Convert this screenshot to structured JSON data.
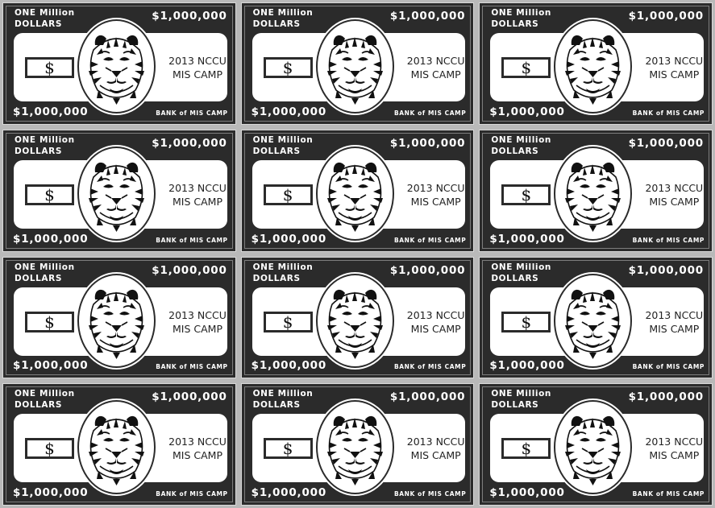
{
  "bills": [
    {
      "denomination_words": "ONE Million\nDOLLARS",
      "amount_top": "$1,000,000",
      "amount_bottom": "$1,000,000",
      "currency_symbol": "$",
      "camp_line1": "2013 NCCU",
      "camp_line2": "MIS CAMP",
      "bank": "BANK of MIS CAMP"
    },
    {
      "denomination_words": "ONE Million\nDOLLARS",
      "amount_top": "$1,000,000",
      "amount_bottom": "$1,000,000",
      "currency_symbol": "$",
      "camp_line1": "2013 NCCU",
      "camp_line2": "MIS CAMP",
      "bank": "BANK of MIS CAMP"
    },
    {
      "denomination_words": "ONE Million\nDOLLARS",
      "amount_top": "$1,000,000",
      "amount_bottom": "$1,000,000",
      "currency_symbol": "$",
      "camp_line1": "2013 NCCU",
      "camp_line2": "MIS CAMP",
      "bank": "BANK of MIS CAMP"
    },
    {
      "denomination_words": "ONE Million\nDOLLARS",
      "amount_top": "$1,000,000",
      "amount_bottom": "$1,000,000",
      "currency_symbol": "$",
      "camp_line1": "2013 NCCU",
      "camp_line2": "MIS CAMP",
      "bank": "BANK of MIS CAMP"
    },
    {
      "denomination_words": "ONE Million\nDOLLARS",
      "amount_top": "$1,000,000",
      "amount_bottom": "$1,000,000",
      "currency_symbol": "$",
      "camp_line1": "2013 NCCU",
      "camp_line2": "MIS CAMP",
      "bank": "BANK of MIS CAMP"
    },
    {
      "denomination_words": "ONE Million\nDOLLARS",
      "amount_top": "$1,000,000",
      "amount_bottom": "$1,000,000",
      "currency_symbol": "$",
      "camp_line1": "2013 NCCU",
      "camp_line2": "MIS CAMP",
      "bank": "BANK of MIS CAMP"
    },
    {
      "denomination_words": "ONE Million\nDOLLARS",
      "amount_top": "$1,000,000",
      "amount_bottom": "$1,000,000",
      "currency_symbol": "$",
      "camp_line1": "2013 NCCU",
      "camp_line2": "MIS CAMP",
      "bank": "BANK of MIS CAMP"
    },
    {
      "denomination_words": "ONE Million\nDOLLARS",
      "amount_top": "$1,000,000",
      "amount_bottom": "$1,000,000",
      "currency_symbol": "$",
      "camp_line1": "2013 NCCU",
      "camp_line2": "MIS CAMP",
      "bank": "BANK of MIS CAMP"
    },
    {
      "denomination_words": "ONE Million\nDOLLARS",
      "amount_top": "$1,000,000",
      "amount_bottom": "$1,000,000",
      "currency_symbol": "$",
      "camp_line1": "2013 NCCU",
      "camp_line2": "MIS CAMP",
      "bank": "BANK of MIS CAMP"
    },
    {
      "denomination_words": "ONE Million\nDOLLARS",
      "amount_top": "$1,000,000",
      "amount_bottom": "$1,000,000",
      "currency_symbol": "$",
      "camp_line1": "2013 NCCU",
      "camp_line2": "MIS CAMP",
      "bank": "BANK of MIS CAMP"
    },
    {
      "denomination_words": "ONE Million\nDOLLARS",
      "amount_top": "$1,000,000",
      "amount_bottom": "$1,000,000",
      "currency_symbol": "$",
      "camp_line1": "2013 NCCU",
      "camp_line2": "MIS CAMP",
      "bank": "BANK of MIS CAMP"
    },
    {
      "denomination_words": "ONE Million\nDOLLARS",
      "amount_top": "$1,000,000",
      "amount_bottom": "$1,000,000",
      "currency_symbol": "$",
      "camp_line1": "2013 NCCU",
      "camp_line2": "MIS CAMP",
      "bank": "BANK of MIS CAMP"
    }
  ],
  "portrait_icon": "tiger-portrait-icon",
  "colors": {
    "bill_background": "#2b2b2b",
    "panel": "#ffffff",
    "sheet": "#b9b9b9"
  }
}
